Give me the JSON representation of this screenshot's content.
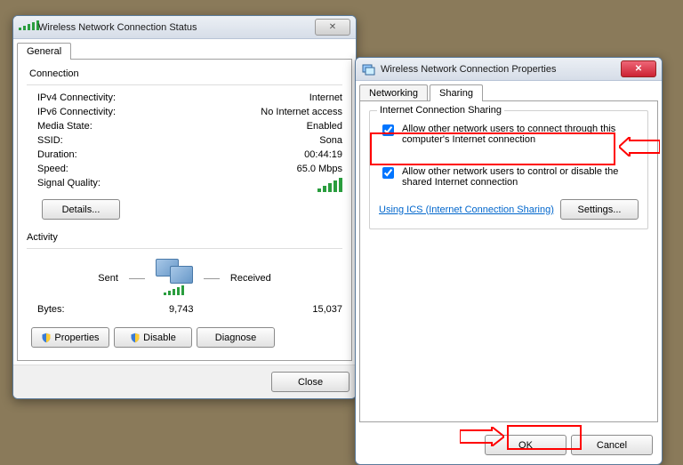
{
  "status": {
    "title": "Wireless Network Connection Status",
    "tabs": {
      "general": "General"
    },
    "connection": {
      "legend": "Connection",
      "ipv4_label": "IPv4 Connectivity:",
      "ipv4_value": "Internet",
      "ipv6_label": "IPv6 Connectivity:",
      "ipv6_value": "No Internet access",
      "media_label": "Media State:",
      "media_value": "Enabled",
      "ssid_label": "SSID:",
      "ssid_value": "Sona",
      "duration_label": "Duration:",
      "duration_value": "00:44:19",
      "speed_label": "Speed:",
      "speed_value": "65.0 Mbps",
      "signal_label": "Signal Quality:",
      "details": "Details..."
    },
    "activity": {
      "legend": "Activity",
      "sent_label": "Sent",
      "received_label": "Received",
      "bytes_label": "Bytes:",
      "sent_value": "9,743",
      "received_value": "15,037"
    },
    "buttons": {
      "properties": "Properties",
      "disable": "Disable",
      "diagnose": "Diagnose",
      "close": "Close"
    }
  },
  "props": {
    "title": "Wireless Network Connection Properties",
    "tabs": {
      "networking": "Networking",
      "sharing": "Sharing"
    },
    "ics": {
      "legend": "Internet Connection Sharing",
      "allow_connect": "Allow other network users to connect through this computer's Internet connection",
      "allow_control": "Allow other network users to control or disable the shared Internet connection",
      "link": "Using ICS (Internet Connection Sharing)",
      "settings": "Settings..."
    },
    "buttons": {
      "ok": "OK",
      "cancel": "Cancel"
    }
  }
}
